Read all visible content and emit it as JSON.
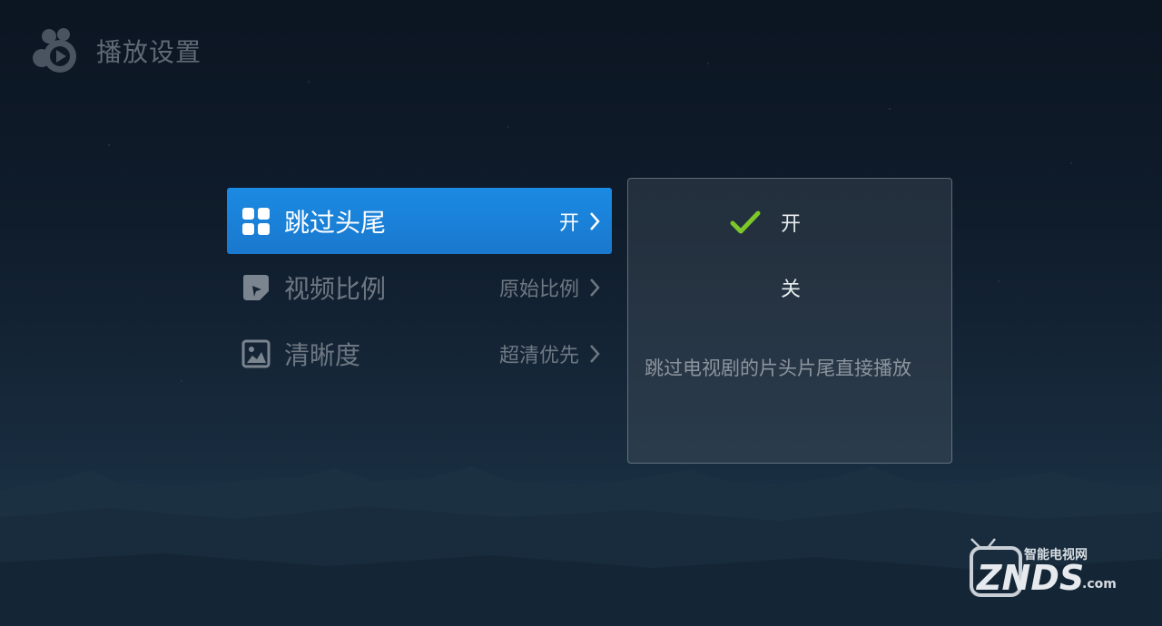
{
  "header": {
    "title": "播放设置",
    "logo_icon": "player-logo-icon"
  },
  "menu": {
    "items": [
      {
        "label": "跳过头尾",
        "value": "开",
        "icon": "grid-icon",
        "active": true
      },
      {
        "label": "视频比例",
        "value": "原始比例",
        "icon": "aspect-ratio-icon",
        "active": false
      },
      {
        "label": "清晰度",
        "value": "超清优先",
        "icon": "image-icon",
        "active": false
      }
    ]
  },
  "panel": {
    "options": [
      {
        "label": "开",
        "selected": true
      },
      {
        "label": "关",
        "selected": false
      }
    ],
    "description": "跳过电视剧的片头片尾直接播放"
  },
  "watermark": {
    "top_text": "智能电视网",
    "main_text": "ZNDS",
    "suffix": ".com"
  },
  "colors": {
    "accent": "#1a80d6",
    "check": "#7cc82a",
    "background": "#0f1c2b"
  }
}
